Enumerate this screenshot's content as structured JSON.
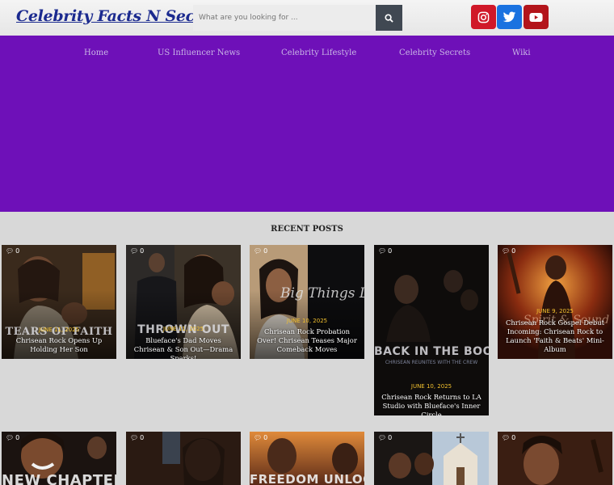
{
  "header": {
    "logo": "Celebrity Facts N Secrets",
    "search_placeholder": "What are you looking for ..."
  },
  "social": [
    {
      "name": "Instagram",
      "icon": "instagram-icon",
      "color": "#d01828"
    },
    {
      "name": "Twitter",
      "icon": "twitter-icon",
      "color": "#1a72e0"
    },
    {
      "name": "YouTube",
      "icon": "youtube-icon",
      "color": "#b3151b"
    }
  ],
  "nav": [
    "Home",
    "US Influencer News",
    "Celebrity Lifestyle",
    "Celebrity Secrets",
    "Wiki"
  ],
  "colors": {
    "nav_band": "#6e10b8",
    "accent_date": "#f2c02e"
  },
  "section_title": "RECENT POSTS",
  "posts": [
    {
      "comments": "0",
      "date": "JUNE 11, 2025",
      "title": "Chrisean Rock Opens Up Holding Her Son",
      "overlay": "TEARS OF FAITH"
    },
    {
      "comments": "0",
      "date": "JUNE 11, 2025",
      "title": "Blueface's Dad Moves Chrisean & Son Out—Drama Sparks!",
      "overlay": "THROWN OUT"
    },
    {
      "comments": "0",
      "date": "JUNE 10, 2025",
      "title": "Chrisean Rock Probation Over! Chrisean Teases Major Comeback Moves",
      "overlay": "Big Things Loading"
    },
    {
      "comments": "0",
      "date": "JUNE 10, 2025",
      "title": "Chrisean Rock Returns to LA Studio with Blueface's Inner Circle",
      "overlay": "BACK IN THE BOOTH",
      "overlay_sub": "CHRISEAN REUNITES WITH THE CREW"
    },
    {
      "comments": "0",
      "date": "JUNE 9, 2025",
      "title": "Chrisean Rock Gospel Debut Incoming: Chrisean Rock to Launch 'Faith & Beats' Mini-Album",
      "overlay": "Spirit & Sound"
    },
    {
      "comments": "0",
      "overlay": "NEW CHAPTER"
    },
    {
      "comments": "0"
    },
    {
      "comments": "0",
      "overlay": "FREEDOM UNLOCKED"
    },
    {
      "comments": "0"
    },
    {
      "comments": "0"
    }
  ]
}
